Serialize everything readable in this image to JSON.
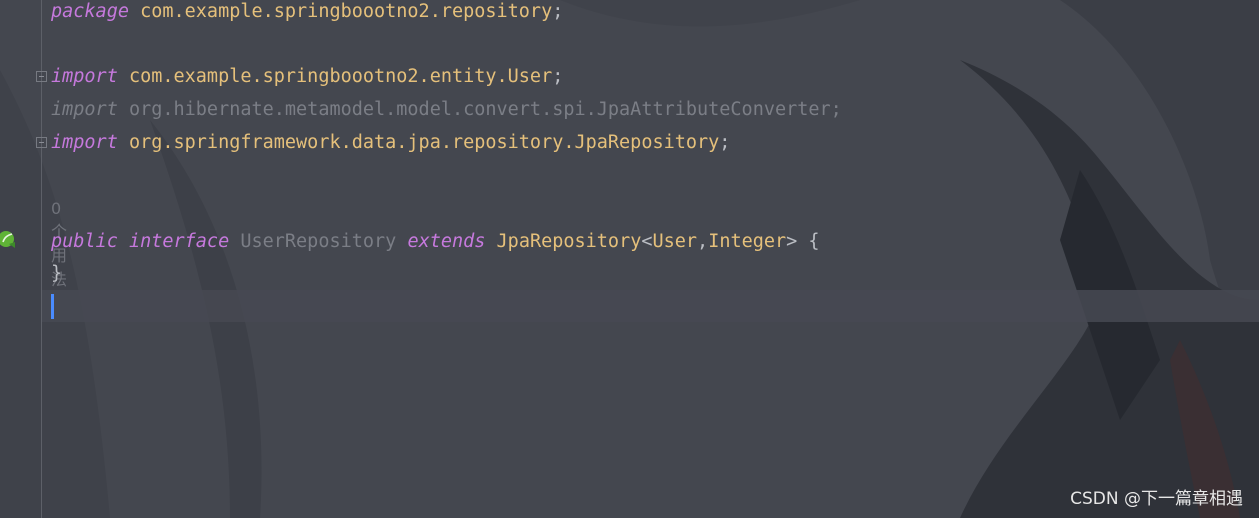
{
  "editor": {
    "lines": {
      "package_kw": "package",
      "package_name": "com.example.springboootno2.repository",
      "package_semi": ";",
      "import1_kw": "import",
      "import1_name": "com.example.springboootno2.entity.User",
      "import1_semi": ";",
      "import2_kw": "import",
      "import2_name": "org.hibernate.metamodel.model.convert.spi.JpaAttributeConverter",
      "import2_semi": ";",
      "import3_kw": "import",
      "import3_name": "org.springframework.data.jpa.repository.JpaRepository",
      "import3_semi": ";",
      "usage_hint": "0 个用法",
      "decl_public": "public",
      "decl_interface": "interface",
      "decl_name": "UserRepository",
      "decl_extends": "extends",
      "decl_parent": "JpaRepository",
      "decl_lt": "<",
      "decl_type1": "User",
      "decl_comma": ",",
      "decl_type2": "Integer",
      "decl_rest": "> {",
      "closing_brace": "}"
    }
  },
  "watermark": "CSDN @下一篇章相遇",
  "icons": {
    "gutter": "spring-bean-icon",
    "fold": "fold-marker-icon"
  },
  "colors": {
    "keyword": "#c679dd",
    "identifier": "#e5c07b",
    "unused": "#7b7e86",
    "caret": "#4a8cff"
  }
}
